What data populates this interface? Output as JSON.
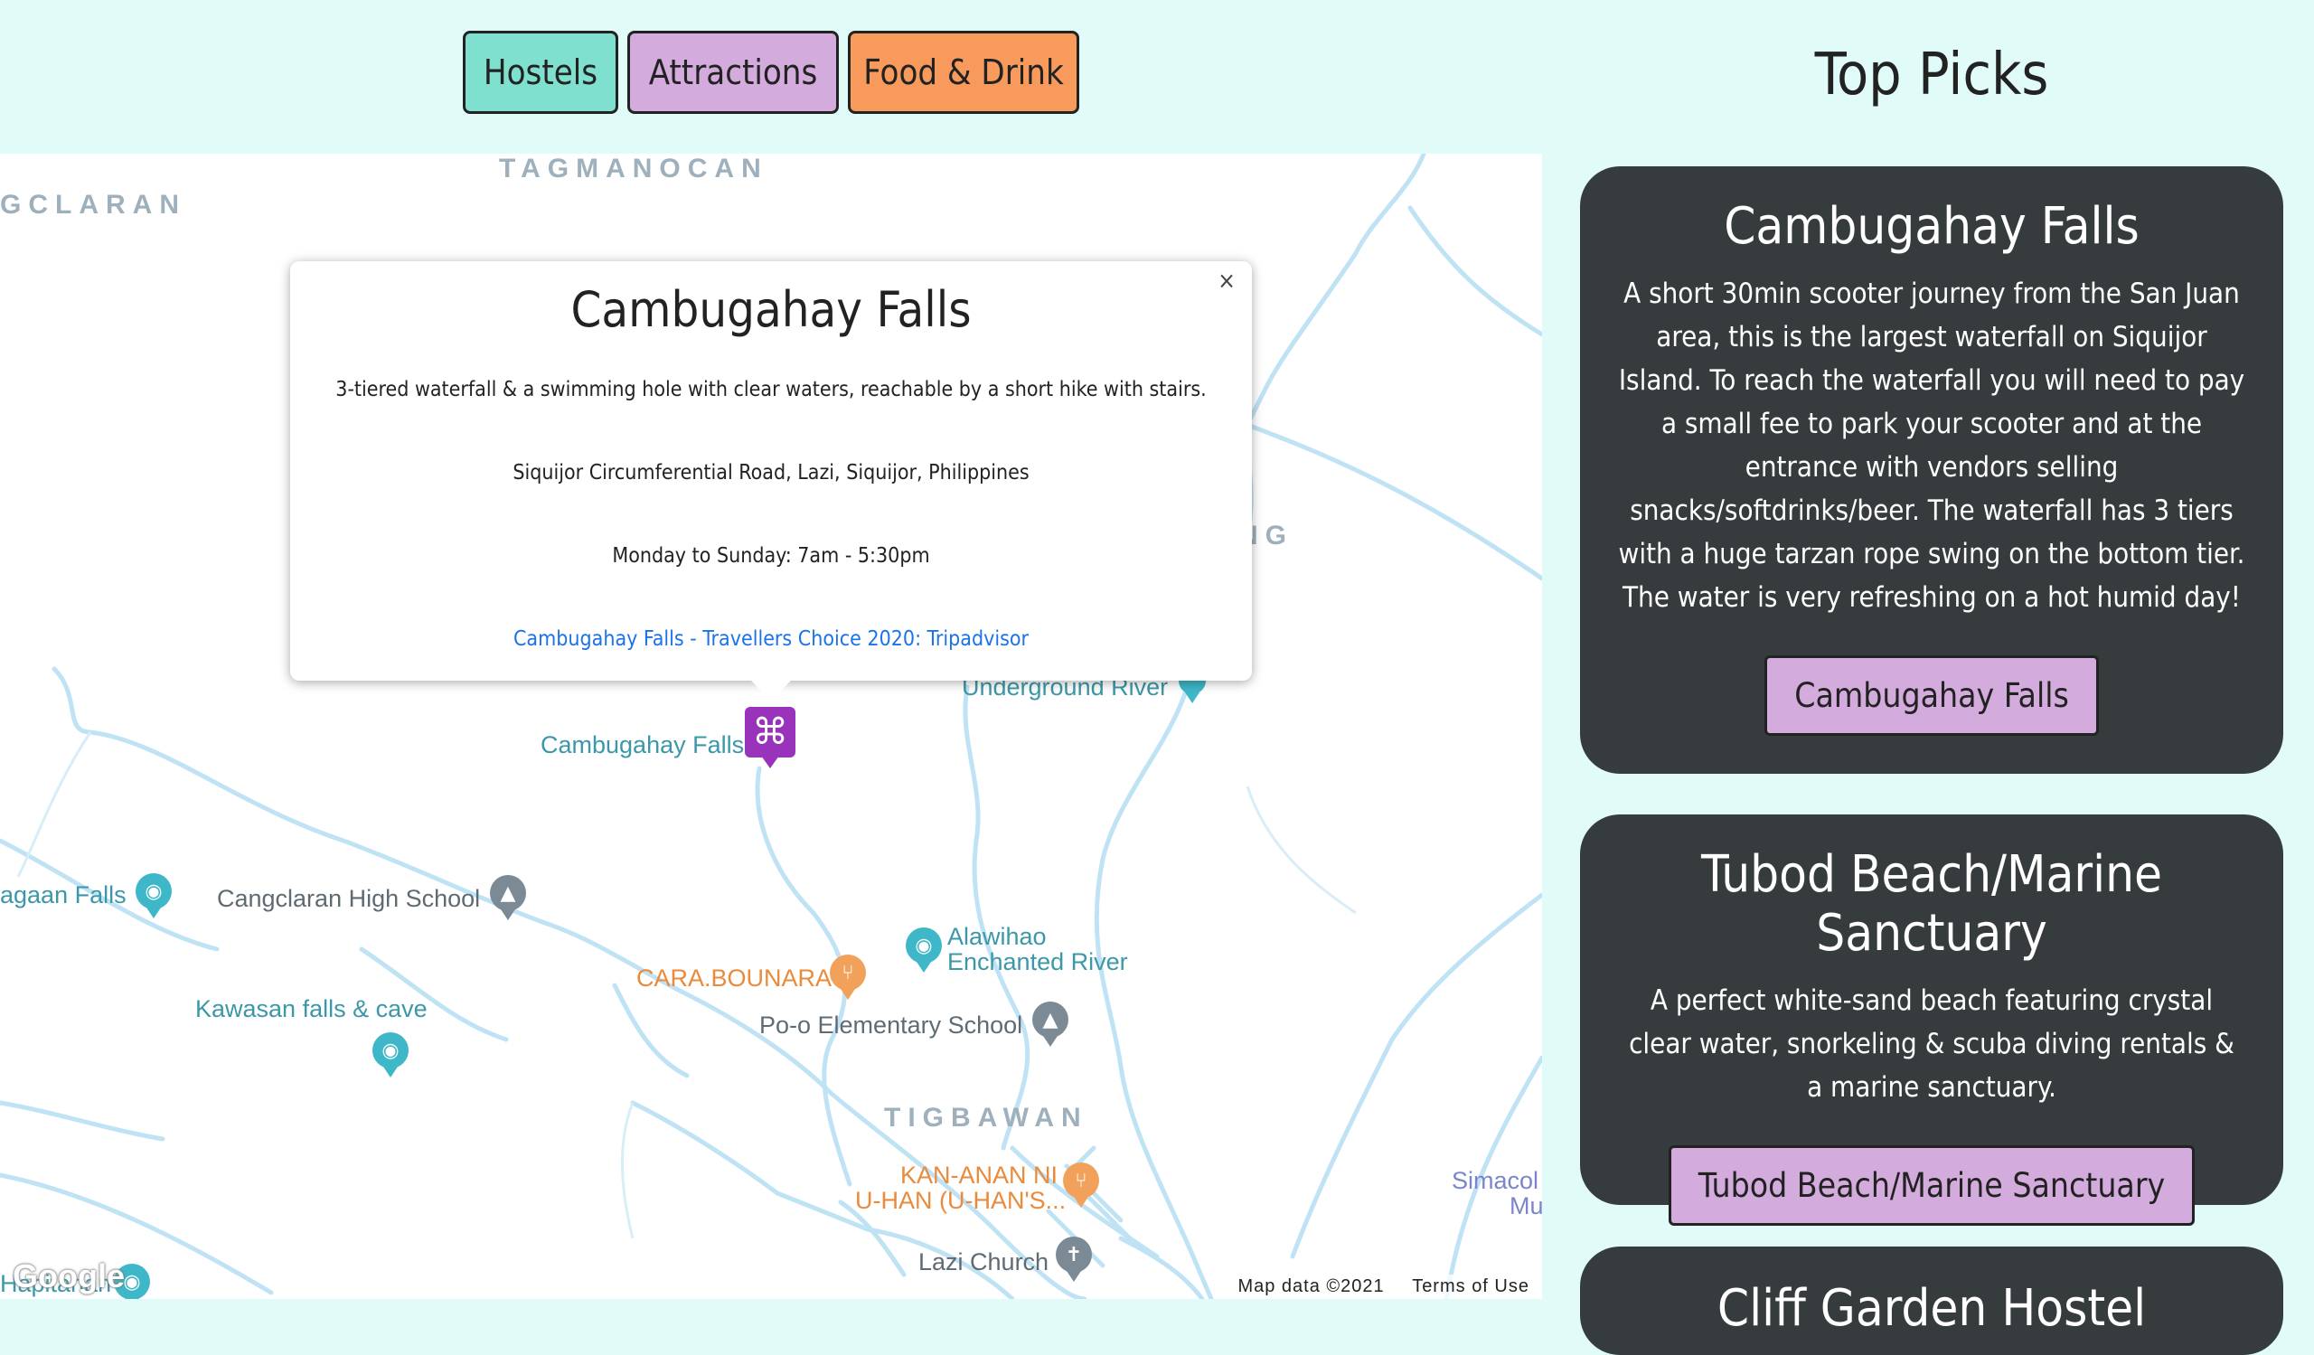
{
  "filters": {
    "hostels": "Hostels",
    "attractions": "Attractions",
    "food": "Food & Drink"
  },
  "map": {
    "areas": {
      "tagmanocan": "TAGMANOCAN",
      "cangclaran": "GCLARAN",
      "ong": "NG",
      "tigbawan": "TIGBAWAN"
    },
    "pois": {
      "underground_river": "Underground River",
      "cambugahay": "Cambugahay Falls",
      "lagaan": "agaan Falls",
      "cangclaran_hs": "Cangclaran High School",
      "alawihao_1": "Alawihao",
      "alawihao_2": "Enchanted River",
      "cara": "CARA.BOUNARA",
      "po_o": "Po-o Elementary School",
      "kawasan": "Kawasan falls & cave",
      "kanan_1": "KAN-ANAN NI",
      "kanan_2": "U-HAN (U-HAN'S...",
      "simacol_1": "Simacol",
      "simacol_2": "Mu",
      "lazi_church": "Lazi Church",
      "hapitanan": "Hapitanan"
    },
    "marker_icon": "command-icon",
    "popup": {
      "title": "Cambugahay Falls",
      "description": "3-tiered waterfall & a swimming hole with clear waters, reachable by a short hike with stairs.",
      "address": "Siquijor Circumferential Road, Lazi, Siquijor, Philippines",
      "hours": "Monday to Sunday: 7am - 5:30pm",
      "link": "Cambugahay Falls - Travellers Choice 2020: Tripadvisor",
      "close": "×"
    },
    "footer": {
      "data": "Map data ©2021",
      "terms": "Terms of Use"
    },
    "logo": "Google"
  },
  "top_picks": {
    "title": "Top Picks",
    "cards": [
      {
        "title": "Cambugahay Falls",
        "description": "A short 30min scooter journey from the San Juan area, this is the largest waterfall on Siquijor Island. To reach the waterfall you will need to pay a small fee to park your scooter and at the entrance with vendors selling snacks/softdrinks/beer. The waterfall has 3 tiers with a huge tarzan rope swing on the bottom tier. The water is very refreshing on a hot humid day!",
        "button": "Cambugahay Falls"
      },
      {
        "title": "Tubod Beach/Marine Sanctuary",
        "description": "A perfect white-sand beach featuring crystal clear water, snorkeling & scuba diving rentals & a marine sanctuary.",
        "button": "Tubod Beach/Marine Sanctuary"
      },
      {
        "title": "Cliff Garden Hostel"
      }
    ]
  },
  "colors": {
    "background": "#e0fbf8",
    "hostels_btn": "#7fe0cf",
    "attractions_btn": "#d3acdd",
    "food_btn": "#f79a5c",
    "card_bg": "#363c3d",
    "marker": "#9933bb"
  }
}
